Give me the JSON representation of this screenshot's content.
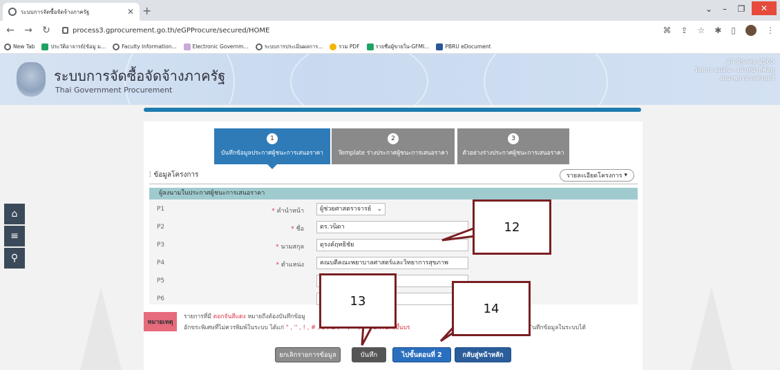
{
  "browser": {
    "tab_title": "ระบบการจัดซื้อจัดจ้างภาครัฐ",
    "url": "process3.gprocurement.go.th/eGPProcure/secured/HOME",
    "bookmarks": [
      "New Tab",
      "ประวัติอาจารย์(ข้อมู ม...",
      "Faculty Information...",
      "Electronic Governm...",
      "ระบบการประเมินผลการ...",
      "รวม PDF",
      "รายชื่อผู้ขายใน-GFMI...",
      "PBRU eDocument"
    ]
  },
  "site": {
    "title": "ระบบการจัดซื้อจัดจ้างภาครัฐ",
    "subtitle": "Thai Government Procurement",
    "date": "24 มีนาคม 2565",
    "user": "วัลลภา ม่แดิน - เจ้าหน้าที่พัสดุ",
    "department": "คณะพยาบาลศาสตร์"
  },
  "steps": [
    {
      "num": "1",
      "label": "บันทึกข้อมูลประกาศผู้ชนะการเสนอราคา"
    },
    {
      "num": "2",
      "label": "Template ร่างประกาศผู้ชนะการเสนอราคา"
    },
    {
      "num": "3",
      "label": "ตัวอย่างร่างประกาศผู้ชนะการเสนอราคา"
    }
  ],
  "section": {
    "title": "ข้อมูลโครงการ",
    "details_button": "รายละเอียดโครงการ",
    "signer_header": "ผู้ลงนามในประกาศผู้ชนะการเสนอราคา"
  },
  "form": {
    "rows": [
      "P1",
      "P2",
      "P3",
      "P4",
      "P5",
      "P6"
    ],
    "prefix_label": "คำนำหน้า",
    "prefix_value": "ผู้ช่วยศาสตราจารย์",
    "name_label": "ชื่อ",
    "name_value": "ดร.วนิดา",
    "surname_label": "นามสกุล",
    "surname_value": "ดุรงค์ฤทธิชัย",
    "position_label": "ตำแหน่ง",
    "position_value": "คณบดีคณะพยาบาลศาสตร์และวิทยาการสุขภาพ",
    "required_mark": "*"
  },
  "note": {
    "badge": "หมายเหตุ",
    "line1_a": "รายการที่มี",
    "line1_red": "ดอกจันสีแดง",
    "line1_b": "หมายถึงต้องบันทึกข้อมู",
    "line2_a": "อักขระพิเศษที่ไม่ควรพิมพ์ในระบบ ได้แก่",
    "line2_chars": "\" , '' , ! , # , $ , & , ^ ,",
    "line2_b": "^ , : , , ENTER(ขึ้นบร",
    "line2_end": "ันทึกข้อมูลในระบบได้"
  },
  "buttons": {
    "cancel": "ยกเลิกรายการข้อมูล",
    "save": "บันทึก",
    "next": "ไปขั้นตอนที่ 2",
    "home": "กลับสู่หน้าหลัก"
  },
  "callouts": {
    "c12": "12",
    "c13": "13",
    "c14": "14"
  }
}
